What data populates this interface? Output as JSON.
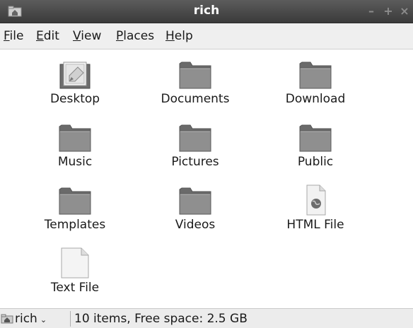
{
  "window": {
    "title": "rich"
  },
  "window_controls": {
    "minimize": "–",
    "maximize": "+",
    "close": "×"
  },
  "menu": [
    {
      "label": "File"
    },
    {
      "label": "Edit"
    },
    {
      "label": "View"
    },
    {
      "label": "Places"
    },
    {
      "label": "Help"
    }
  ],
  "items": [
    {
      "label": "Desktop",
      "icon": "desktop-folder-icon"
    },
    {
      "label": "Documents",
      "icon": "folder-icon"
    },
    {
      "label": "Download",
      "icon": "folder-icon"
    },
    {
      "label": "Music",
      "icon": "folder-icon"
    },
    {
      "label": "Pictures",
      "icon": "folder-icon"
    },
    {
      "label": "Public",
      "icon": "folder-icon"
    },
    {
      "label": "Templates",
      "icon": "folder-icon"
    },
    {
      "label": "Videos",
      "icon": "folder-icon"
    },
    {
      "label": "HTML File",
      "icon": "html-file-icon"
    },
    {
      "label": "Text File",
      "icon": "text-file-icon"
    }
  ],
  "statusbar": {
    "location": "rich",
    "info": "10 items, Free space: 2.5 GB"
  }
}
